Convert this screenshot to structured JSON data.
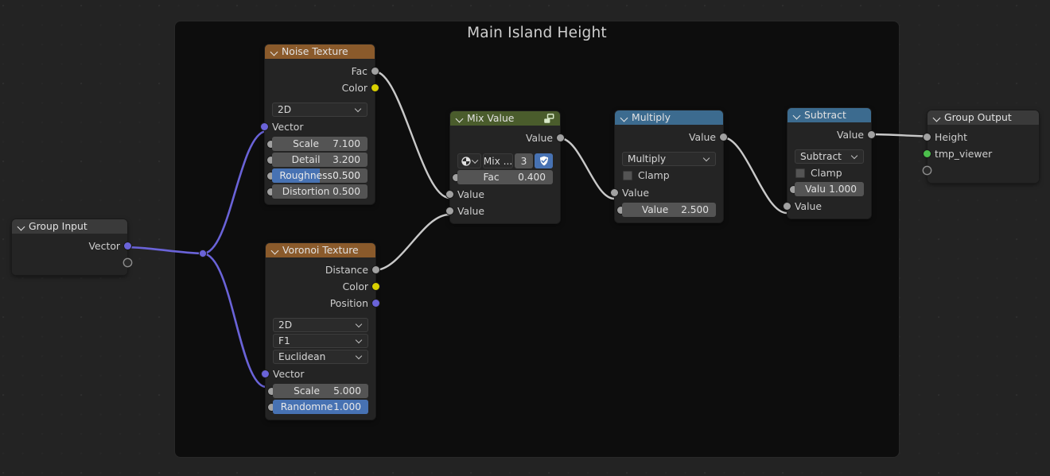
{
  "editor": {
    "background_color": "#232323",
    "frame_color": "#0d0d0d"
  },
  "frame": {
    "label": "Main Island Height"
  },
  "colors": {
    "texture_header": "#8a5a2b",
    "converter_header": "#3c6b8f",
    "group_header": "#3a3a3a",
    "mix_header": "#4a5c2c",
    "slider_fill": "#4772b3",
    "socket_gray": "#a1a1a1",
    "socket_yellow": "#d9d000",
    "socket_vector": "#6a63d8",
    "socket_green": "#4cbf4c"
  },
  "nodes": {
    "group_input": {
      "title": "Group Input",
      "outputs": [
        {
          "label": "Vector",
          "socket": "vector"
        },
        {
          "label": "",
          "socket": "empty"
        }
      ]
    },
    "noise_texture": {
      "title": "Noise Texture",
      "outputs": [
        {
          "label": "Fac",
          "socket": "gray"
        },
        {
          "label": "Color",
          "socket": "yellow"
        }
      ],
      "dimension": "2D",
      "inputs": [
        {
          "label": "Vector",
          "socket": "vector"
        }
      ],
      "values": [
        {
          "label": "Scale",
          "value": "7.100",
          "socket": "gray",
          "style": "number"
        },
        {
          "label": "Detail",
          "value": "3.200",
          "socket": "gray",
          "style": "number"
        },
        {
          "label": "Roughness",
          "value": "0.500",
          "socket": "gray",
          "style": "slider",
          "fill_pct": 50
        },
        {
          "label": "Distortion",
          "value": "0.500",
          "socket": "gray",
          "style": "number"
        }
      ]
    },
    "voronoi_texture": {
      "title": "Voronoi Texture",
      "outputs": [
        {
          "label": "Distance",
          "socket": "gray"
        },
        {
          "label": "Color",
          "socket": "yellow"
        },
        {
          "label": "Position",
          "socket": "vector"
        }
      ],
      "dimension": "2D",
      "feature": "F1",
      "metric": "Euclidean",
      "inputs": [
        {
          "label": "Vector",
          "socket": "vector"
        }
      ],
      "values": [
        {
          "label": "Scale",
          "value": "5.000",
          "socket": "gray",
          "style": "number"
        },
        {
          "label": "Randomne",
          "value": "1.000",
          "socket": "gray",
          "style": "slider",
          "fill_pct": 100
        }
      ]
    },
    "mix_value": {
      "title": "Mix Value",
      "header_icon": "node-group-icon",
      "outputs": [
        {
          "label": "Value",
          "socket": "gray"
        }
      ],
      "datablock": {
        "browse_icon": "browse-datablock-icon",
        "name": "Mix ...",
        "users": "3",
        "fake_user_icon": "shield-icon",
        "fake_user_active": true
      },
      "fac": {
        "label": "Fac",
        "value": "0.400"
      },
      "inputs": [
        {
          "label": "Value",
          "socket": "gray"
        },
        {
          "label": "Value",
          "socket": "gray"
        }
      ]
    },
    "multiply": {
      "title": "Multiply",
      "outputs": [
        {
          "label": "Value",
          "socket": "gray"
        }
      ],
      "operation": "Multiply",
      "clamp": {
        "label": "Clamp",
        "checked": false
      },
      "inputs": [
        {
          "label": "Value",
          "socket": "gray",
          "style": "socket_only"
        },
        {
          "label": "Value",
          "value": "2.500",
          "socket": "gray",
          "style": "number"
        }
      ]
    },
    "subtract": {
      "title": "Subtract",
      "outputs": [
        {
          "label": "Value",
          "socket": "gray"
        }
      ],
      "operation": "Subtract",
      "clamp": {
        "label": "Clamp",
        "checked": false
      },
      "inputs": [
        {
          "label": "Valu",
          "value": "1.000",
          "socket": "gray",
          "style": "number"
        },
        {
          "label": "Value",
          "socket": "gray",
          "style": "socket_only"
        }
      ]
    },
    "group_output": {
      "title": "Group Output",
      "inputs": [
        {
          "label": "Height",
          "socket": "gray"
        },
        {
          "label": "tmp_viewer",
          "socket": "green"
        },
        {
          "label": "",
          "socket": "empty"
        }
      ]
    }
  },
  "links": [
    {
      "from": "group-input-vector",
      "to": "reroute"
    },
    {
      "from": "reroute",
      "to": "noise-vector-input"
    },
    {
      "from": "reroute",
      "to": "voronoi-vector-input"
    },
    {
      "from": "noise-fac-output",
      "to": "mix-value-input-1"
    },
    {
      "from": "voronoi-distance-output",
      "to": "mix-value-input-2"
    },
    {
      "from": "mix-value-output",
      "to": "multiply-value-input-1"
    },
    {
      "from": "multiply-value-output",
      "to": "subtract-value-input-2"
    },
    {
      "from": "subtract-value-output",
      "to": "group-output-height"
    }
  ]
}
